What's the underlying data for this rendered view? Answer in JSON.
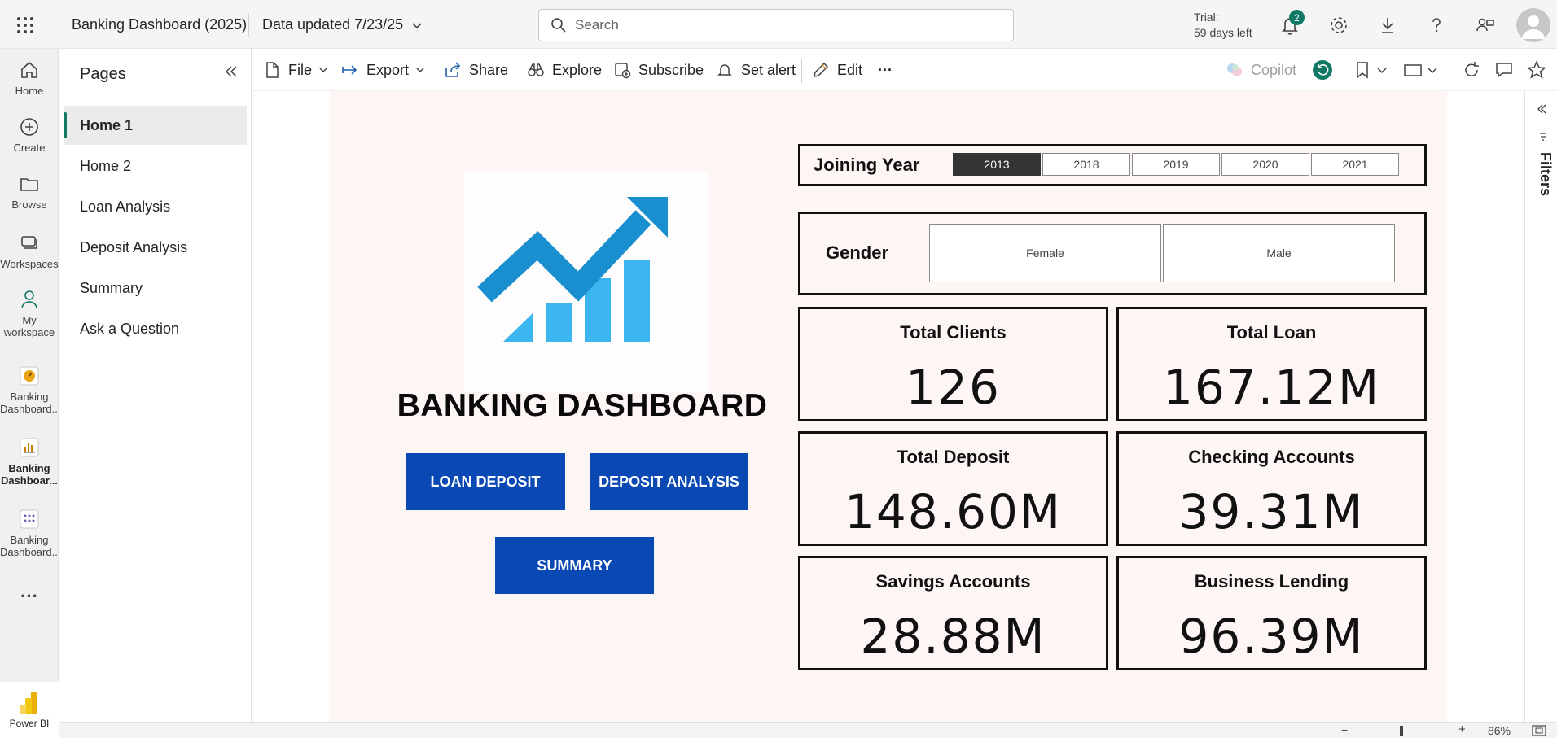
{
  "topbar": {
    "app_title": "Banking Dashboard (2025)",
    "data_updated": "Data updated 7/23/25",
    "search_placeholder": "Search",
    "trial_line1": "Trial:",
    "trial_line2": "59 days left",
    "notification_count": "2",
    "icons": [
      "app-launcher-icon",
      "bell-icon",
      "gear-icon",
      "download-icon",
      "help-icon",
      "share-people-icon",
      "avatar"
    ]
  },
  "left_rail": {
    "items": [
      {
        "label": "Home",
        "icon": "home-icon"
      },
      {
        "label": "Create",
        "icon": "plus-circle-icon"
      },
      {
        "label": "Browse",
        "icon": "folder-icon"
      },
      {
        "label": "Workspaces",
        "icon": "workspaces-icon"
      },
      {
        "label_line1": "My",
        "label_line2": "workspace",
        "icon": "person-icon"
      },
      {
        "label_line1": "Banking",
        "label_line2": "Dashboard...",
        "icon": "gauge-icon"
      },
      {
        "label_line1": "Banking",
        "label_line2": "Dashboar...",
        "icon": "report-icon"
      },
      {
        "label_line1": "Banking",
        "label_line2": "Dashboard...",
        "icon": "dataset-icon"
      }
    ],
    "more_label": "···",
    "product_label": "Power BI"
  },
  "pages_panel": {
    "heading": "Pages",
    "pages": [
      "Home 1",
      "Home 2",
      "Loan Analysis",
      "Deposit Analysis",
      "Summary",
      "Ask a Question"
    ],
    "active_index": 0
  },
  "toolbar": {
    "file": "File",
    "export": "Export",
    "share": "Share",
    "explore": "Explore",
    "subscribe": "Subscribe",
    "set_alert": "Set alert",
    "edit": "Edit",
    "more": "···",
    "copilot": "Copilot"
  },
  "report": {
    "title": "BANKING DASHBOARD",
    "nav_buttons": {
      "loan_deposit": "LOAN DEPOSIT",
      "deposit_analysis": "DEPOSIT ANALYSIS",
      "summary": "SUMMARY"
    },
    "joining_year": {
      "title": "Joining Year",
      "years": [
        "2013",
        "2018",
        "2019",
        "2020",
        "2021"
      ],
      "selected": "2013"
    },
    "gender": {
      "title": "Gender",
      "options": [
        "Female",
        "Male"
      ]
    },
    "kpis": {
      "total_clients": {
        "label": "Total Clients",
        "value": "126"
      },
      "total_loan": {
        "label": "Total Loan",
        "value": "167.12M"
      },
      "total_deposit": {
        "label": "Total Deposit",
        "value": "148.60M"
      },
      "checking_accounts": {
        "label": "Checking Accounts",
        "value": "39.31M"
      },
      "savings_accounts": {
        "label": "Savings Accounts",
        "value": "28.88M"
      },
      "business_lending": {
        "label": "Business Lending",
        "value": "96.39M"
      }
    },
    "colors": {
      "nav_button": "#0a48b4",
      "page_background": "#fdf6f5",
      "logo_blue": "#1a8fd0",
      "logo_light_blue": "#3cb6f0",
      "accent_green": "#117865"
    }
  },
  "filters_pane": {
    "label": "Filters"
  },
  "statusbar": {
    "zoom": "86%",
    "zoom_level": 0.86
  }
}
